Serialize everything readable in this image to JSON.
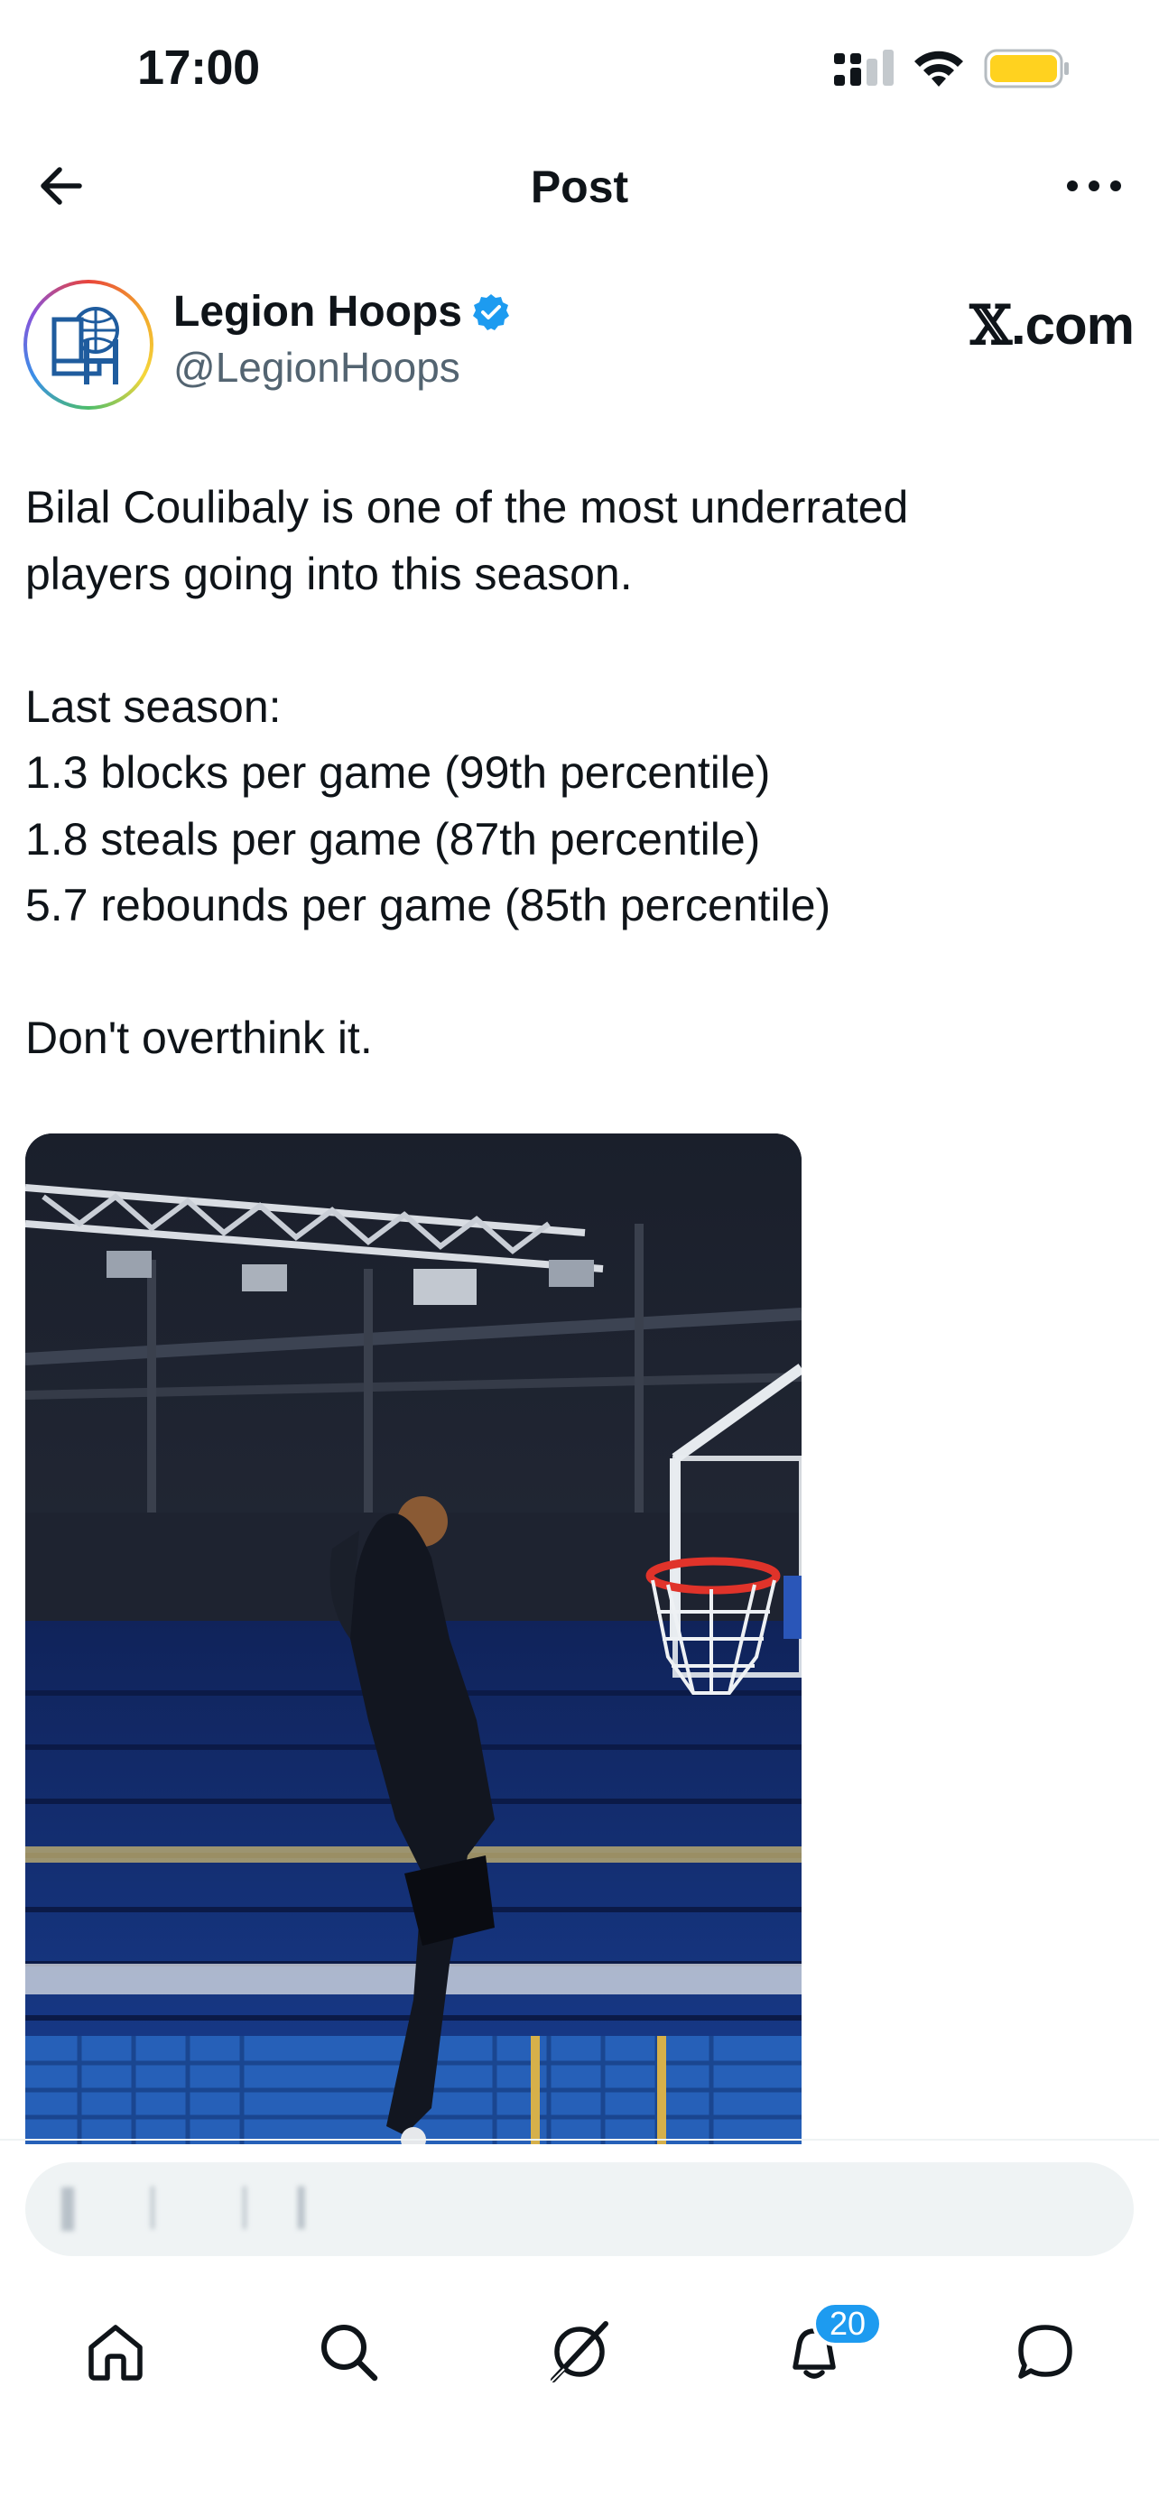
{
  "status_bar": {
    "time": "17:00",
    "icons": [
      "cellular-signal-icon",
      "wifi-icon",
      "battery-low-power-icon"
    ],
    "battery_color": "#ffd21f"
  },
  "header": {
    "title": "Post",
    "back_icon": "arrow-left-icon",
    "more_icon": "more-horizontal-icon"
  },
  "post": {
    "author": {
      "name": "Legion Hoops",
      "handle": "@LegionHoops",
      "verified": true,
      "verified_color": "#1d9bf0"
    },
    "source_label_glyph": "𝕏",
    "source_label_suffix": ".com",
    "text_lines": [
      "Bilal Coulibaly is one of the most underrated",
      "players going into this season.",
      "",
      "Last season:",
      "1.3 blocks per game (99th percentile)",
      "1.8 steals per game (87th percentile)",
      "5.7 rebounds per game (85th percentile)",
      "",
      "Don't overthink it."
    ]
  },
  "reply_bar": {
    "placeholder": "▌ ▏ ▏▎"
  },
  "bottom_nav": {
    "items": [
      {
        "name": "home",
        "icon": "home-icon"
      },
      {
        "name": "search",
        "icon": "search-icon"
      },
      {
        "name": "grok",
        "icon": "grok-icon"
      },
      {
        "name": "notifications",
        "icon": "bell-icon"
      },
      {
        "name": "messages",
        "icon": "message-icon"
      }
    ],
    "notification_count": "20",
    "accent": "#1d9bf0"
  }
}
